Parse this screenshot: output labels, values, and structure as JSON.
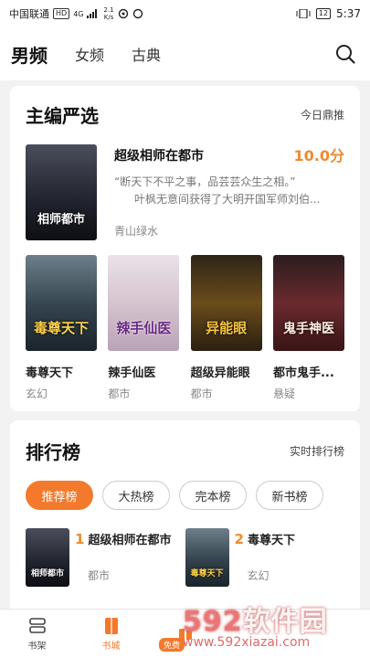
{
  "status": {
    "carrier": "中国联通",
    "hd": "HD",
    "net": "4G",
    "speed": "2.1",
    "speed_unit": "K/s",
    "battery": "12",
    "time": "5:37"
  },
  "nav": {
    "tabs": [
      "男频",
      "女频",
      "古典"
    ],
    "active": "男频"
  },
  "editor_pick": {
    "title": "主编严选",
    "link": "今日鼎推",
    "featured": {
      "title": "超级相师在都市",
      "score": "10.0分",
      "desc_line1": "“断天下不平之事，品芸芸众生之相。”",
      "desc_line2": "叶枫无意间获得了大明开国军师刘伯...",
      "author": "青山绿水",
      "cover_text": "相师都市"
    },
    "books": [
      {
        "title": "毒尊天下",
        "category": "玄幻",
        "cover_text": "毒尊天下",
        "bg": "#3a4a55"
      },
      {
        "title": "辣手仙医",
        "category": "都市",
        "cover_text": "辣手仙医",
        "bg": "#d9c7d2"
      },
      {
        "title": "超级异能眼",
        "category": "都市",
        "cover_text": "异能眼",
        "bg": "#5a4320"
      },
      {
        "title": "都市鬼手...",
        "category": "悬疑",
        "cover_text": "鬼手神医",
        "bg": "#5b2226"
      }
    ]
  },
  "ranking": {
    "title": "排行榜",
    "link": "实时排行榜",
    "tabs": [
      "推荐榜",
      "大热榜",
      "完本榜",
      "新书榜"
    ],
    "active_tab": "推荐榜",
    "items": [
      {
        "rank": "1",
        "title": "超级相师在都市",
        "category": "都市",
        "cover_text": "相师都市"
      },
      {
        "rank": "2",
        "title": "毒尊天下",
        "category": "玄幻",
        "cover_text": "毒尊天下"
      }
    ]
  },
  "bottom_nav": {
    "items": [
      "书架",
      "书城"
    ],
    "active": "书城",
    "free_tag": "免费"
  },
  "watermark": {
    "line1_num": "592",
    "line1_text": "软件园",
    "line2": "www.592xiazai.com"
  },
  "colors": {
    "accent": "#f37a2c",
    "score": "#f08a2b"
  }
}
